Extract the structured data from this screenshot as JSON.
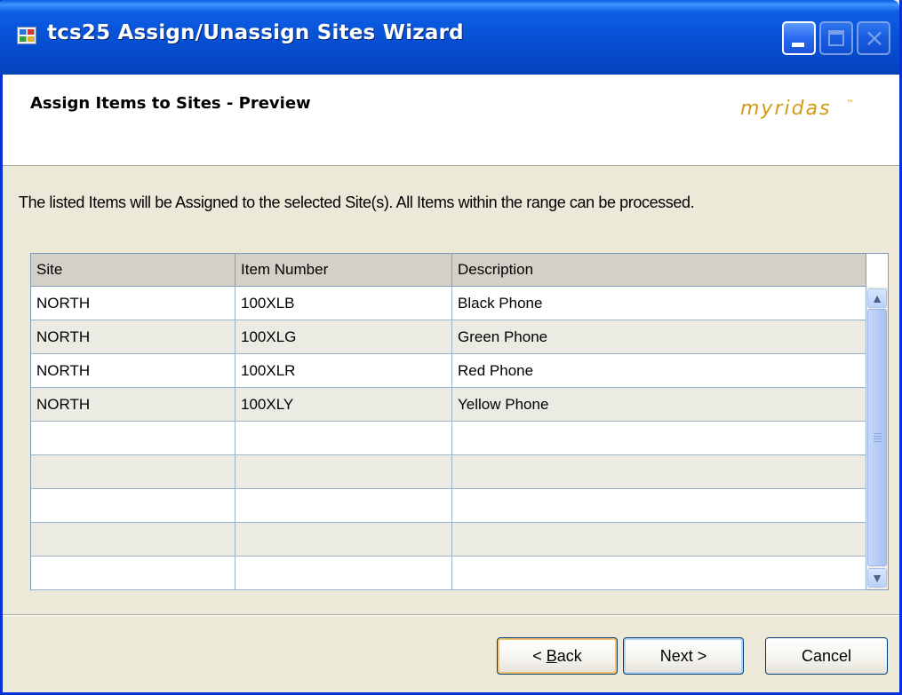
{
  "window": {
    "title": "tcs25 Assign/Unassign Sites Wizard",
    "controls": {
      "minimize": "minimize",
      "maximize": "maximize",
      "close": "×"
    }
  },
  "header": {
    "title": "Assign Items to Sites - Preview",
    "brand": "myridas",
    "brand_tm": "™"
  },
  "instruction": "The listed Items will be Assigned to the selected Site(s). All Items within the range can be processed.",
  "grid": {
    "columns": [
      "Site",
      "Item Number",
      "Description"
    ],
    "rows": [
      {
        "site": "NORTH",
        "item": "100XLB",
        "desc": "Black Phone"
      },
      {
        "site": "NORTH",
        "item": "100XLG",
        "desc": "Green Phone"
      },
      {
        "site": "NORTH",
        "item": "100XLR",
        "desc": "Red Phone"
      },
      {
        "site": "NORTH",
        "item": "100XLY",
        "desc": "Yellow Phone"
      },
      {
        "site": "",
        "item": "",
        "desc": ""
      },
      {
        "site": "",
        "item": "",
        "desc": ""
      },
      {
        "site": "",
        "item": "",
        "desc": ""
      },
      {
        "site": "",
        "item": "",
        "desc": ""
      },
      {
        "site": "",
        "item": "",
        "desc": ""
      }
    ]
  },
  "buttons": {
    "back_prefix": "< ",
    "back_accel": "B",
    "back_rest": "ack",
    "next": "Next >",
    "cancel": "Cancel"
  },
  "colors": {
    "title_bar": "#0751d5",
    "brand": "#d49a14",
    "row_alt": "#ebebe3"
  }
}
